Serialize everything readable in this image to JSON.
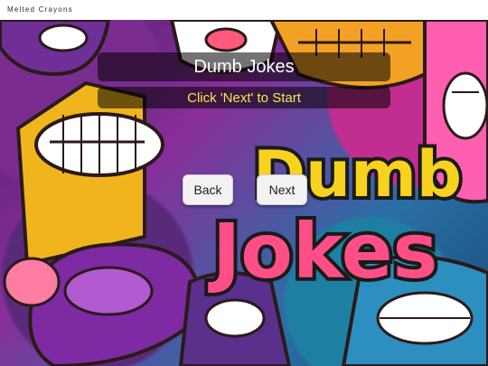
{
  "app": {
    "brand": "Melted Crayons"
  },
  "hero": {
    "logo_line1": "Dumb",
    "logo_line2": "Jokes"
  },
  "overlay": {
    "title": "Dumb Jokes",
    "subtitle": "Click 'Next' to Start"
  },
  "controls": {
    "back_label": "Back",
    "next_label": "Next"
  },
  "colors": {
    "title_text": "#ffffff",
    "subtitle_text": "#f4e94a",
    "logo_fill": "#f7d21f",
    "logo_pink": "#ff4f86",
    "overlay_bg": "#000000"
  }
}
